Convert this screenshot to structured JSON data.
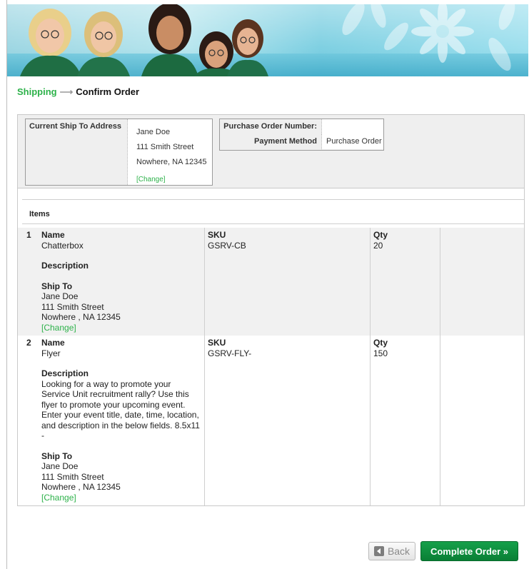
{
  "breadcrumb": {
    "shipping": "Shipping",
    "arrow": "⟶",
    "current": "Confirm Order"
  },
  "summary": {
    "ship_to_label": "Current Ship To Address",
    "address": {
      "name": "Jane Doe",
      "street": "111 Smith Street",
      "city": "Nowhere, NA 12345",
      "change": "[Change]"
    },
    "po_number_label": "Purchase Order Number:",
    "po_number_value": "",
    "payment_method_label": "Payment Method",
    "payment_method_value": "Purchase Order"
  },
  "items_title": "Items",
  "items": [
    {
      "num": "1",
      "name_label": "Name",
      "name": "Chatterbox",
      "description_label": "Description",
      "description": "",
      "ship_to_label": "Ship To",
      "ship_name": "Jane Doe",
      "ship_street": "111 Smith Street",
      "ship_city": "Nowhere , NA 12345",
      "change": "[Change]",
      "sku_label": "SKU",
      "sku": "GSRV-CB",
      "qty_label": "Qty",
      "qty": "20"
    },
    {
      "num": "2",
      "name_label": "Name",
      "name": "Flyer",
      "description_label": "Description",
      "description": "Looking for a way to promote your Service Unit recruitment rally? Use this flyer to promote your upcoming event. Enter your event title, date, time, location, and description in the below fields. 8.5x11 -",
      "ship_to_label": "Ship To",
      "ship_name": "Jane Doe",
      "ship_street": "111 Smith Street",
      "ship_city": "Nowhere , NA 12345",
      "change": "[Change]",
      "sku_label": "SKU",
      "sku": "GSRV-FLY-",
      "qty_label": "Qty",
      "qty": "150"
    }
  ],
  "buttons": {
    "back": "Back",
    "complete": "Complete Order »"
  },
  "colors": {
    "link_green": "#2db24a",
    "button_green": "#0a7f35"
  },
  "icons": {
    "back": "arrow-left-icon"
  }
}
